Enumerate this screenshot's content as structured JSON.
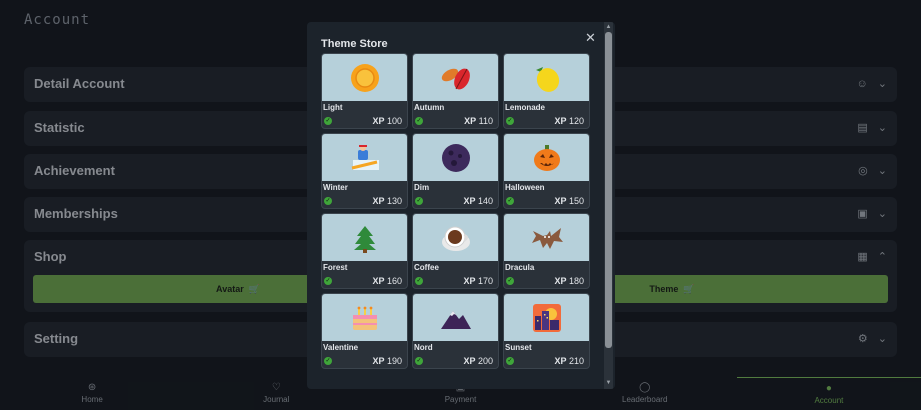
{
  "page": {
    "title": "Account"
  },
  "panels": [
    {
      "label": "Detail Account",
      "icon": "user-icon"
    },
    {
      "label": "Statistic",
      "icon": "chart-icon"
    },
    {
      "label": "Achievement",
      "icon": "target-icon"
    },
    {
      "label": "Memberships",
      "icon": "id-card-icon"
    },
    {
      "label": "Shop",
      "icon": "store-icon"
    },
    {
      "label": "Setting",
      "icon": "gear-icon"
    }
  ],
  "shop": {
    "avatar_label": "Avatar",
    "theme_label": "Theme"
  },
  "nav": [
    {
      "label": "Home",
      "icon": "compass-icon"
    },
    {
      "label": "Journal",
      "icon": "heart-icon"
    },
    {
      "label": "Payment",
      "icon": "wallet-icon"
    },
    {
      "label": "Leaderboard",
      "icon": "trophy-icon"
    },
    {
      "label": "Account",
      "icon": "account-icon"
    }
  ],
  "modal": {
    "title": "Theme Store",
    "xp_prefix": "XP",
    "themes": [
      {
        "name": "Light",
        "xp": "100",
        "icon": "sun-icon"
      },
      {
        "name": "Autumn",
        "xp": "110",
        "icon": "leaves-icon"
      },
      {
        "name": "Lemonade",
        "xp": "120",
        "icon": "lemon-icon"
      },
      {
        "name": "Winter",
        "xp": "130",
        "icon": "snowboarder-icon"
      },
      {
        "name": "Dim",
        "xp": "140",
        "icon": "moon-icon"
      },
      {
        "name": "Halloween",
        "xp": "150",
        "icon": "pumpkin-icon"
      },
      {
        "name": "Forest",
        "xp": "160",
        "icon": "tree-icon"
      },
      {
        "name": "Coffee",
        "xp": "170",
        "icon": "coffee-icon"
      },
      {
        "name": "Dracula",
        "xp": "180",
        "icon": "bat-icon"
      },
      {
        "name": "Valentine",
        "xp": "190",
        "icon": "cake-icon"
      },
      {
        "name": "Nord",
        "xp": "200",
        "icon": "mountain-icon"
      },
      {
        "name": "Sunset",
        "xp": "210",
        "icon": "city-sunset-icon"
      }
    ]
  },
  "colors": {
    "accent": "#6fa74f",
    "card_bg": "#b6d0da",
    "check": "#3fa53a"
  }
}
